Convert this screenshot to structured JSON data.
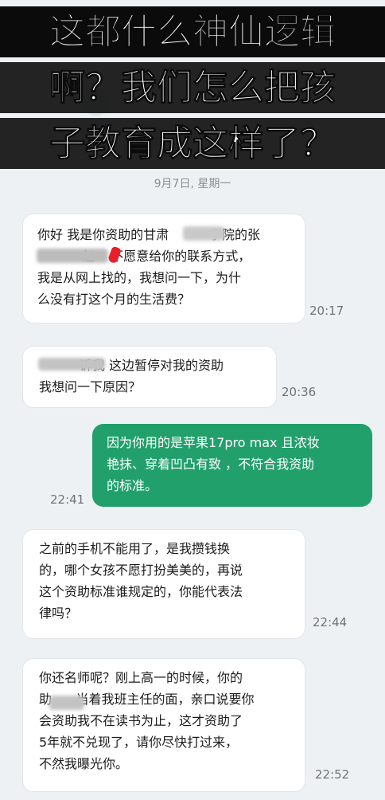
{
  "headline": {
    "line1": "这都什么神仙逻辑",
    "line2": "啊？我们怎么把孩",
    "line3": "子教育成这样了？"
  },
  "chat": {
    "date_separator": "9月7日, 星期一",
    "messages": [
      {
        "direction": "incoming",
        "text": "你好 我是你资助的甘肃          学院的张\n           赵    不愿意给你的联系方式，\n我是从网上找的，我想问一下，为什\n么没有打这个月的生活费？",
        "time": "20:17"
      },
      {
        "direction": "incoming",
        "text": "          诉我 这边暂停对我的资助\n我想问一下原因？",
        "time": "20:36"
      },
      {
        "direction": "outgoing",
        "text": "因为你用的是苹果17pro max 且浓妆\n艳抹、穿着凹凸有致 ，不符合我资助\n的标准。",
        "time": "22:41"
      },
      {
        "direction": "incoming",
        "text": "之前的手机不能用了，是我攒钱换\n的，哪个女孩不愿打扮美美的，再说\n这个资助标准谁规定的，你能代表法\n律吗？",
        "time": "22:44"
      },
      {
        "direction": "incoming",
        "text": "你还名师呢？刚上高一的时候，你的\n助      当着我班主任的面，亲口说要你\n会资助我不在读书为止，这才资助了\n5年就不兑现了，请你尽快打过来，\n不然我曝光你。",
        "time": "22:52"
      }
    ]
  }
}
